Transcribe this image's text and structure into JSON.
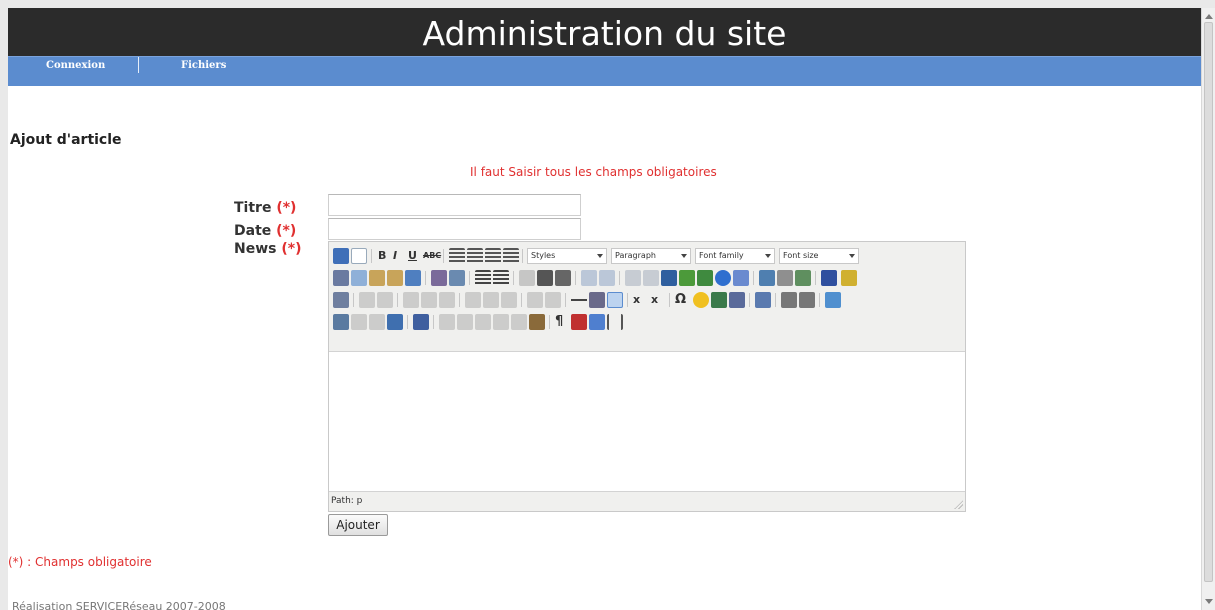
{
  "header": {
    "title": "Administration du site"
  },
  "nav": {
    "items": [
      "Connexion",
      "Fichiers"
    ]
  },
  "section": {
    "title": "Ajout d'article"
  },
  "form": {
    "error": "Il faut Saisir tous les champs obligatoires",
    "fields": [
      {
        "label": "Titre",
        "required": "(*)",
        "value": ""
      },
      {
        "label": "Date",
        "required": "(*)",
        "value": ""
      },
      {
        "label": "News",
        "required": "(*)"
      }
    ],
    "editor": {
      "selects": [
        "Styles",
        "Paragraph",
        "Font family",
        "Font size"
      ],
      "bold": "B",
      "italic": "I",
      "underline": "U",
      "strike": "ABC",
      "subscript": "x",
      "superscript": "x",
      "omega": "Ω",
      "pilcrow": "¶",
      "path": "Path: p"
    },
    "submit": "Ajouter"
  },
  "footnote": "(*) : Champs obligatoire",
  "footer": {
    "copyright": "Réalisation SERVICERéseau 2007-2008"
  },
  "colors": {
    "header": "#2b2b2b",
    "nav": "#5b8ccf",
    "error": "#e03030"
  }
}
